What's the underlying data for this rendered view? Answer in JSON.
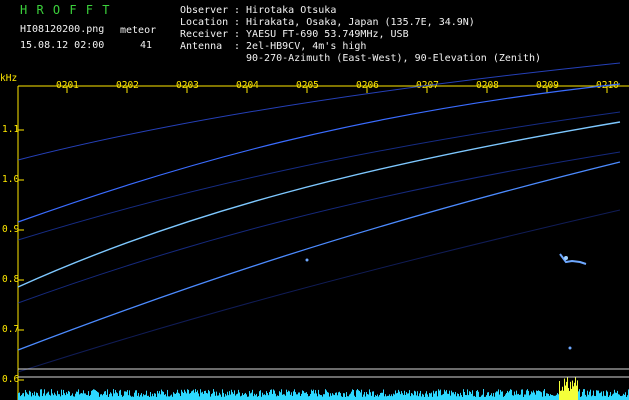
{
  "header": {
    "brand": "H R O F F T",
    "file": "HI08120200.png",
    "datetime": "15.08.12 02:00",
    "count_label": "meteor",
    "count_value": "41",
    "observer_label": "Observer",
    "observer_value": ": Hirotaka Otsuka",
    "location_label": "Location",
    "location_value": ": Hirakata, Osaka, Japan (135.7E, 34.9N)",
    "receiver_label": "Receiver",
    "receiver_value": ": YAESU FT-690 53.749MHz, USB",
    "antenna_label": "Antenna",
    "antenna_value": ": 2el-HB9CV, 4m's high",
    "antenna_value2": "90-270-Azimuth (East-West), 90-Elevation (Zenith)"
  },
  "axis": {
    "unit": "kHz",
    "y_ticks": [
      "1.1",
      "1.0",
      "0.9",
      "0.8",
      "0.7",
      "0.6"
    ],
    "time_ticks": [
      "0201",
      "0202",
      "0203",
      "0204",
      "0205",
      "0206",
      "0207",
      "0208",
      "0209",
      "0210"
    ]
  },
  "colors": {
    "tick_text": "#ffe800",
    "trace": "#3a6cff",
    "trace_bright": "#b6f7ff",
    "signal_bar": "#2dd8ff",
    "burst": "#f4ff3a"
  }
}
